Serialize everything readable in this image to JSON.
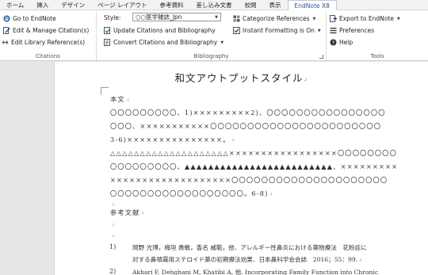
{
  "tabs": [
    {
      "label": "ホーム"
    },
    {
      "label": "挿入"
    },
    {
      "label": "デザイン"
    },
    {
      "label": "ページ レイアウト"
    },
    {
      "label": "参考資料"
    },
    {
      "label": "差し込み文書"
    },
    {
      "label": "校閲"
    },
    {
      "label": "表示"
    },
    {
      "label": "EndNote X8",
      "active": true
    }
  ],
  "ribbon": {
    "citations": {
      "go_to_endnote": "Go to EndNote",
      "edit_manage": "Edit & Manage Citation(s)",
      "edit_library": "Edit Library Reference(s)",
      "group_label": "Citations"
    },
    "bibliography": {
      "style_label": "Style:",
      "style_value": "○○医学雑誌_Jpn",
      "update": "Update Citations and Bibliography",
      "convert": "Convert Citations and Bibliography",
      "categorize": "Categorize References",
      "instant_formatting": "Instant Formatting is On",
      "group_label": "Bibliography"
    },
    "tools": {
      "export": "Export to EndNote",
      "preferences": "Preferences",
      "help": "Help",
      "group_label": "Tools"
    }
  },
  "document": {
    "title": "和文アウトプットスタイル",
    "body_heading": "本文",
    "lines": [
      "〇〇〇〇〇〇〇〇〇、1)×××××××××2)、〇〇〇〇〇〇〇〇〇〇〇〇〇〇〇〇",
      "〇〇〇、×××××××××××〇〇〇〇〇〇〇〇〇〇〇〇〇〇〇〇〇〇〇〇〇〇〇",
      "3-6)×××××××××××××××。",
      "△△△△△△△△△△△△△△△△△△△△×××××××××××××××××〇〇〇〇〇〇〇〇",
      "〇〇〇〇〇〇〇〇〇、▲▲▲▲▲▲▲▲▲▲▲▲▲▲▲▲▲▲▲▲▲▲▲▲▲、×××××××××",
      "×××××××××××××××××××〇〇〇〇〇〇〇〇〇〇〇〇〇〇〇〇〇〇〇〇〇",
      "〇〇〇〇〇〇〇〇〇〇〇〇〇〇〇〇〇〇。6-8)"
    ],
    "references_heading": "参考文献",
    "references": [
      {
        "num": "1)",
        "line1": "岡野 光博，梅垣 貴敏，香名 威範，他．アレルギー性鼻炎における薬物療法　花粉症に",
        "line2": "対する鼻噴霧用ステロイド薬の初期療法効果．日本鼻科学会会誌　2016；55：99."
      },
      {
        "num": "2)",
        "line1": "Akhari F, Dehghani M, Khatibi A, 他. Incorporating Family Function into Chronic",
        "line2": ""
      }
    ]
  }
}
